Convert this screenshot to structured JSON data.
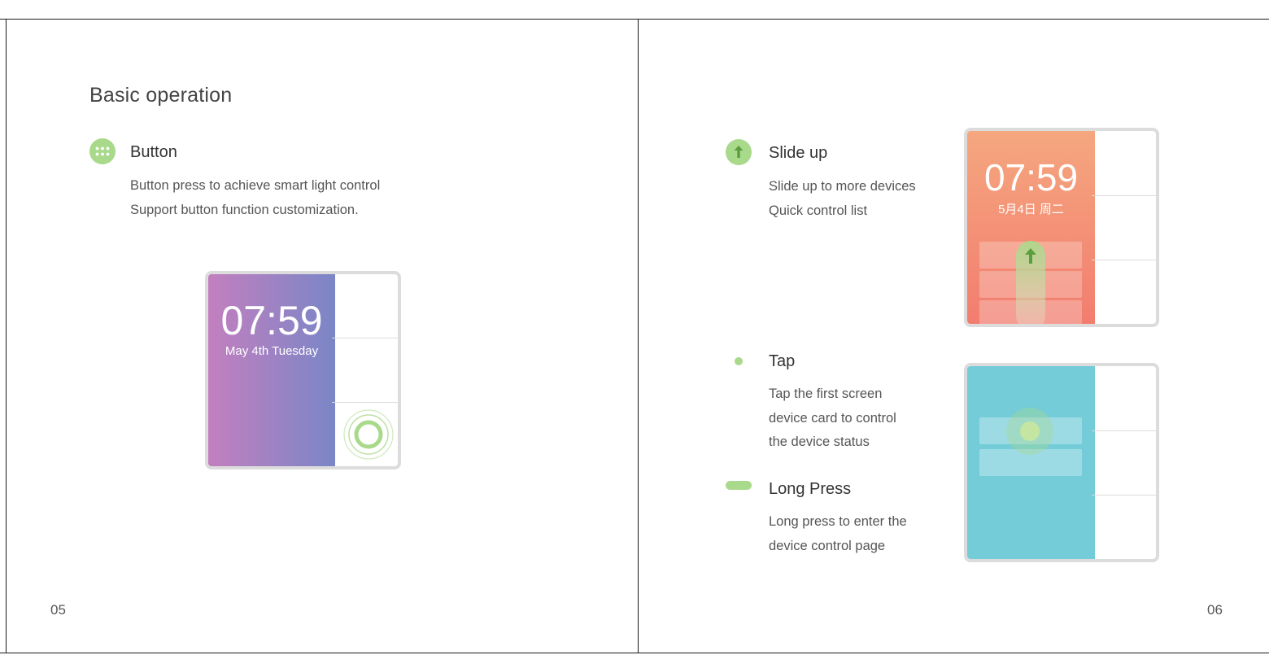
{
  "left_page": {
    "title": "Basic operation",
    "page_number": "05",
    "button_section": {
      "icon": "dots-grid-icon",
      "title": "Button",
      "description": [
        "Button press to achieve smart light control",
        "Support button function customization."
      ]
    },
    "device": {
      "time": "07:59",
      "date": "May 4th Tuesday"
    }
  },
  "right_page": {
    "page_number": "06",
    "slide_up": {
      "icon": "arrow-up-icon",
      "title": "Slide up",
      "description": [
        "Slide up to more devices",
        "Quick control list"
      ]
    },
    "tap": {
      "icon": "dot-icon",
      "title": "Tap",
      "description": [
        "Tap the first screen",
        "device card to control",
        "the device status"
      ]
    },
    "long_press": {
      "icon": "pill-icon",
      "title": "Long Press",
      "description": [
        "Long press to enter the",
        "device control page"
      ]
    },
    "device_top": {
      "time": "07:59",
      "date": "5月4日 周二"
    }
  },
  "colors": {
    "accent_green": "#a9d98a",
    "purple": "#c37fbf",
    "indigo": "#7a86c7",
    "orange": "#f5a77f",
    "coral": "#f27d6f",
    "teal": "#73ccd8"
  }
}
